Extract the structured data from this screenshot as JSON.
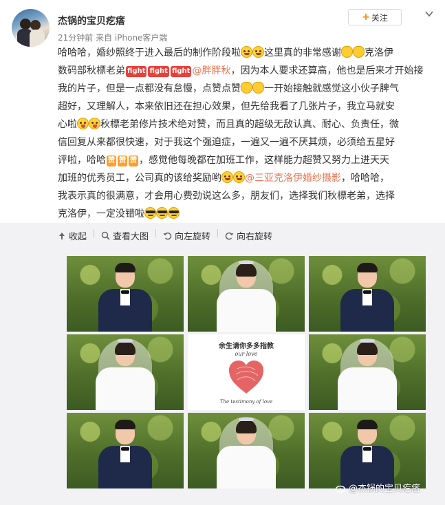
{
  "post": {
    "username": "杰锅的宝贝疙瘩",
    "time": "21分钟前",
    "source": "来自 iPhone客户端",
    "follow_label": "关注",
    "lines": [
      {
        "a": "哈哈哈，婚纱照终于进入最后的制作阶段啦",
        "b": "这里真的非常感谢",
        "c": "克洛伊"
      },
      {
        "a": "数码部秋標老弟",
        "mention": "@胖胖秋",
        "b": "，因为本人要求还算高，他也是后来才开始接"
      },
      {
        "a": "我的片子，但是一点都没有怠慢，点赞点赞",
        "b": "一开始接触就感觉这小伙子脾气"
      },
      {
        "a": "超好，又理解人，本来依旧还在担心效果，但先给我看了几张片子，我立马就安"
      },
      {
        "a": "心啦",
        "b": "秋標老弟修片技术绝对赞，而且真的超级无敌认真、耐心、负责任，微"
      },
      {
        "a": "信回复从来都很快速，对于我这个强迫症，一遍又一遍不厌其烦，必须给五星好"
      },
      {
        "a": "评啦，哈哈",
        "b": "，感觉他每晚都在加班工作，这样能力超赞又努力上进天天"
      },
      {
        "a": "加班的优秀员工，公司真的该给奖励哟",
        "mention": "@三亚克洛伊婚纱摄影",
        "b": "，哈哈哈，"
      },
      {
        "a": "我表示真的很满意，才会用心费劲说这么多，朋友们，选择我们秋標老弟，选择"
      },
      {
        "a": "克洛伊，一定没错啦"
      }
    ],
    "stickers": {
      "jiayou": "fight",
      "zan": "赞"
    }
  },
  "toolbar": {
    "collapse": "收起",
    "view_large": "查看大图",
    "rotate_left": "向左旋转",
    "rotate_right": "向右旋转"
  },
  "center_card": {
    "top_text": "余生请你多多指教",
    "script_text": "our love",
    "bottom_text": "The testimony of love"
  },
  "watermark": "@杰锅的宝贝疙瘩",
  "colors": {
    "link": "#eb7350",
    "accent": "#ff8200"
  }
}
